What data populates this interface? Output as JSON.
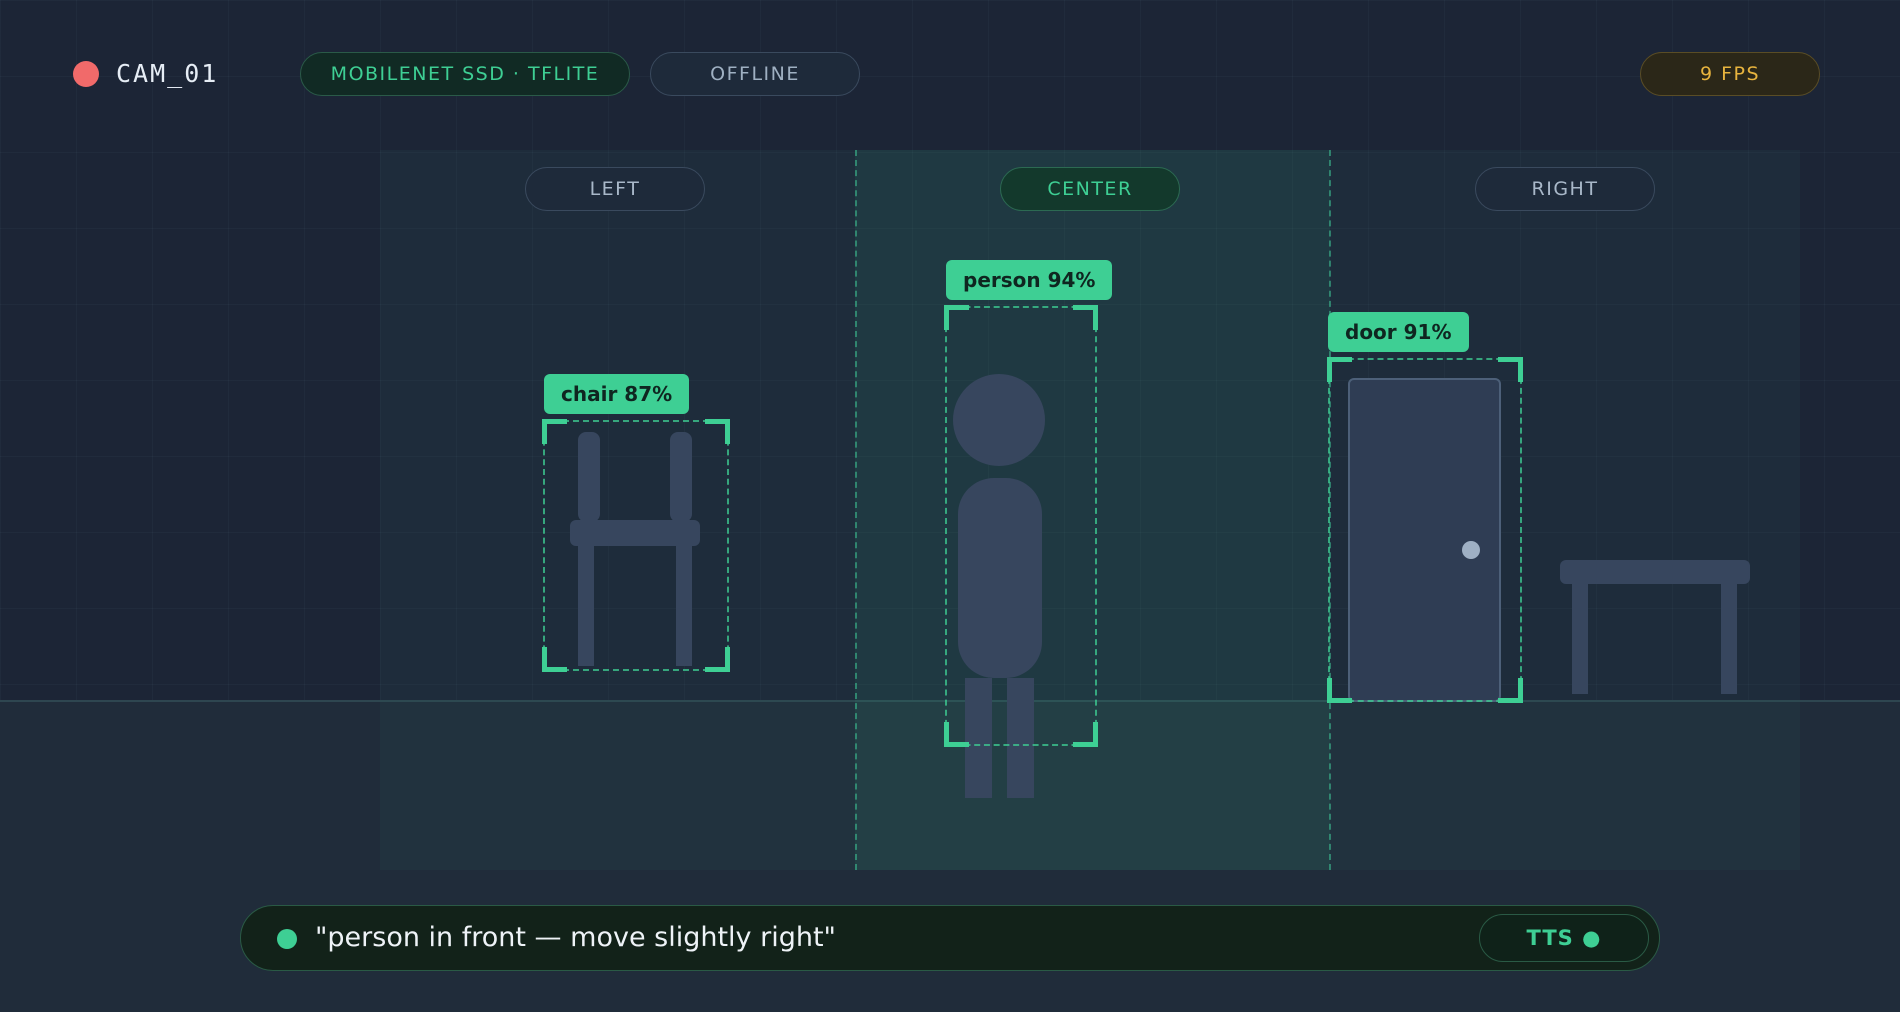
{
  "header": {
    "camera_name": "CAM_01",
    "model_label": "MOBILENET SSD · TFLITE",
    "connection_status": "OFFLINE",
    "fps_label": "9 FPS"
  },
  "zones": {
    "left": "LEFT",
    "center": "CENTER",
    "right": "RIGHT",
    "active": "center"
  },
  "detections": [
    {
      "label": "chair 87%",
      "zone": "left"
    },
    {
      "label": "person 94%",
      "zone": "center"
    },
    {
      "label": "door 91%",
      "zone": "right"
    }
  ],
  "caption": {
    "text": "\"person in front — move slightly right\"",
    "tts_label": "TTS ●"
  },
  "colors": {
    "background": "#1c2536",
    "accent": "#3ecf94",
    "recording": "#f16a6a",
    "fps": "#e8b43e"
  },
  "icons": {
    "recording": "record-dot-icon",
    "caption": "speaking-dot-icon"
  }
}
